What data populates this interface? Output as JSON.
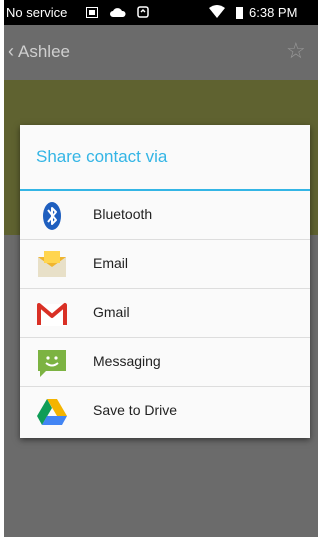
{
  "status_bar": {
    "carrier": "No service",
    "time": "6:38 PM",
    "icons": [
      "screenshot-icon",
      "cloud-icon",
      "sync-icon",
      "wifi-icon",
      "battery-icon"
    ]
  },
  "action_bar": {
    "title": "Ashlee",
    "back_icon": "chevron-left-icon",
    "star_icon": "star-outline-icon"
  },
  "dialog": {
    "title": "Share contact via",
    "accent_color": "#33b5e5",
    "options": [
      {
        "label": "Bluetooth",
        "icon": "bluetooth-icon"
      },
      {
        "label": "Email",
        "icon": "email-icon"
      },
      {
        "label": "Gmail",
        "icon": "gmail-icon"
      },
      {
        "label": "Messaging",
        "icon": "messaging-icon"
      },
      {
        "label": "Save to Drive",
        "icon": "drive-icon"
      }
    ]
  }
}
